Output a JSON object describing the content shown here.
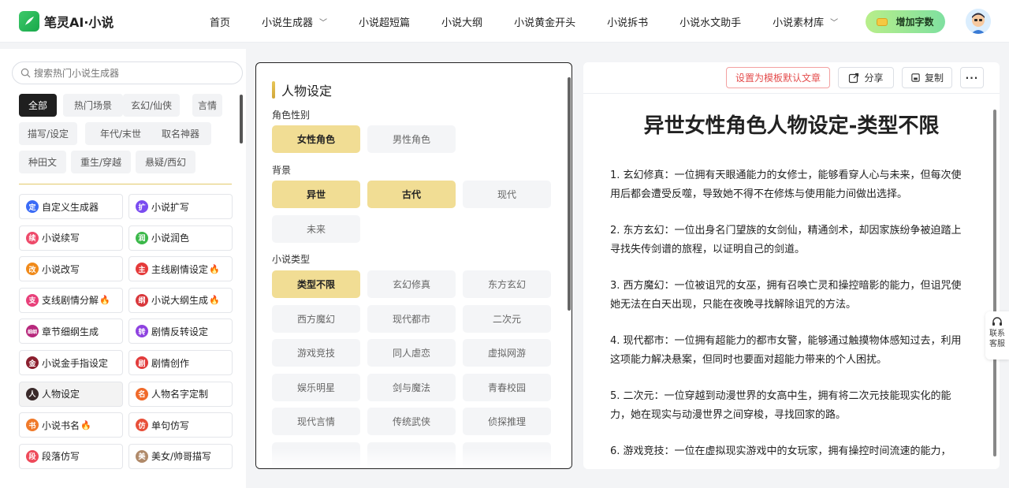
{
  "header": {
    "brand": "笔灵AI·小说",
    "nav": [
      {
        "label": "首页",
        "dropdown": false
      },
      {
        "label": "小说生成器",
        "dropdown": true
      },
      {
        "label": "小说超短篇",
        "dropdown": false
      },
      {
        "label": "小说大纲",
        "dropdown": false
      },
      {
        "label": "小说黄金开头",
        "dropdown": false
      },
      {
        "label": "小说拆书",
        "dropdown": false
      },
      {
        "label": "小说水文助手",
        "dropdown": false
      },
      {
        "label": "小说素材库",
        "dropdown": true
      }
    ],
    "add_words": "增加字数"
  },
  "sidebar": {
    "search_placeholder": "搜索热门小说生成器",
    "tags": [
      "全部",
      "热门场景",
      "玄幻/仙侠",
      "言情",
      "描写/设定",
      "年代/末世",
      "取名神器",
      "种田文",
      "重生/穿越",
      "悬疑/西幻"
    ],
    "active_tag": "全部",
    "generators": [
      {
        "label": "自定义生成器",
        "icon": "定",
        "color": "#3b6cf6",
        "hot": false
      },
      {
        "label": "小说扩写",
        "icon": "扩",
        "color": "#7a4cf0",
        "hot": false
      },
      {
        "label": "小说续写",
        "icon": "续",
        "color": "#ee4a6a",
        "hot": false
      },
      {
        "label": "小说润色",
        "icon": "润",
        "color": "#3bb84a",
        "hot": false
      },
      {
        "label": "小说改写",
        "icon": "改",
        "color": "#f08a1a",
        "hot": false
      },
      {
        "label": "主线剧情设定",
        "icon": "主",
        "color": "#e53a3a",
        "hot": true
      },
      {
        "label": "支线剧情分解",
        "icon": "支",
        "color": "#e8407a",
        "hot": true
      },
      {
        "label": "小说大纲生成",
        "icon": "纲",
        "color": "#d9383c",
        "hot": true
      },
      {
        "label": "章节细纲生成",
        "icon": "细纲",
        "color": "#b7287c",
        "hot": false
      },
      {
        "label": "剧情反转设定",
        "icon": "转",
        "color": "#8e42e0",
        "hot": false
      },
      {
        "label": "小说金手指设定",
        "icon": "金",
        "color": "#8b1f2e",
        "hot": false
      },
      {
        "label": "剧情创作",
        "icon": "剧",
        "color": "#e23c3c",
        "hot": false
      },
      {
        "label": "人物设定",
        "icon": "人",
        "color": "#3a2a2a",
        "hot": false,
        "selected": true
      },
      {
        "label": "人物名字定制",
        "icon": "名",
        "color": "#f06a2a",
        "hot": false
      },
      {
        "label": "小说书名",
        "icon": "书",
        "color": "#f07a2a",
        "hot": true
      },
      {
        "label": "单句仿写",
        "icon": "仿",
        "color": "#e8503a",
        "hot": false
      },
      {
        "label": "段落仿写",
        "icon": "段",
        "color": "#ee4a5a",
        "hot": false
      },
      {
        "label": "美女/帅哥描写",
        "icon": "美",
        "color": "#b08a6a",
        "hot": false
      }
    ]
  },
  "form": {
    "title": "人物设定",
    "sections": [
      {
        "label": "角色性别",
        "options": [
          {
            "label": "女性角色",
            "on": true
          },
          {
            "label": "男性角色",
            "on": false
          }
        ]
      },
      {
        "label": "背景",
        "options": [
          {
            "label": "异世",
            "on": true
          },
          {
            "label": "古代",
            "on": true
          },
          {
            "label": "现代",
            "on": false
          },
          {
            "label": "未来",
            "on": false
          }
        ]
      },
      {
        "label": "小说类型",
        "options": [
          {
            "label": "类型不限",
            "on": true
          },
          {
            "label": "玄幻修真",
            "on": false
          },
          {
            "label": "东方玄幻",
            "on": false
          },
          {
            "label": "西方魔幻",
            "on": false
          },
          {
            "label": "现代都市",
            "on": false
          },
          {
            "label": "二次元",
            "on": false
          },
          {
            "label": "游戏竞技",
            "on": false
          },
          {
            "label": "同人虐恋",
            "on": false
          },
          {
            "label": "虚拟网游",
            "on": false
          },
          {
            "label": "娱乐明星",
            "on": false
          },
          {
            "label": "剑与魔法",
            "on": false
          },
          {
            "label": "青春校园",
            "on": false
          },
          {
            "label": "现代言情",
            "on": false
          },
          {
            "label": "传统武侠",
            "on": false
          },
          {
            "label": "侦探推理",
            "on": false
          }
        ]
      }
    ]
  },
  "result": {
    "set_default": "设置为模板默认文章",
    "share": "分享",
    "copy": "复制",
    "title": "异世女性角色人物设定-类型不限",
    "paragraphs": [
      "1. 玄幻修真：一位拥有天眼通能力的女修士，能够看穿人心与未来，但每次使用后都会遭受反噬，导致她不得不在修炼与使用能力间做出选择。",
      "2. 东方玄幻：一位出身名门望族的女剑仙，精通剑术，却因家族纷争被迫踏上寻找失传剑谱的旅程，以证明自己的剑道。",
      "3. 西方魔幻：一位被诅咒的女巫，拥有召唤亡灵和操控暗影的能力，但诅咒使她无法在白天出现，只能在夜晚寻找解除诅咒的方法。",
      "4. 现代都市：一位拥有超能力的都市女警，能够通过触摸物体感知过去，利用这项能力解决悬案，但同时也要面对超能力带来的个人困扰。",
      "5. 二次元：一位穿越到动漫世界的女高中生，拥有将二次元技能现实化的能力，她在现实与动漫世界之间穿梭，寻找回家的路。",
      "6. 游戏竞技：一位在虚拟现实游戏中的女玩家，拥有操控时间流速的能力，"
    ]
  },
  "contact": {
    "line1": "联系",
    "line2": "客服"
  }
}
